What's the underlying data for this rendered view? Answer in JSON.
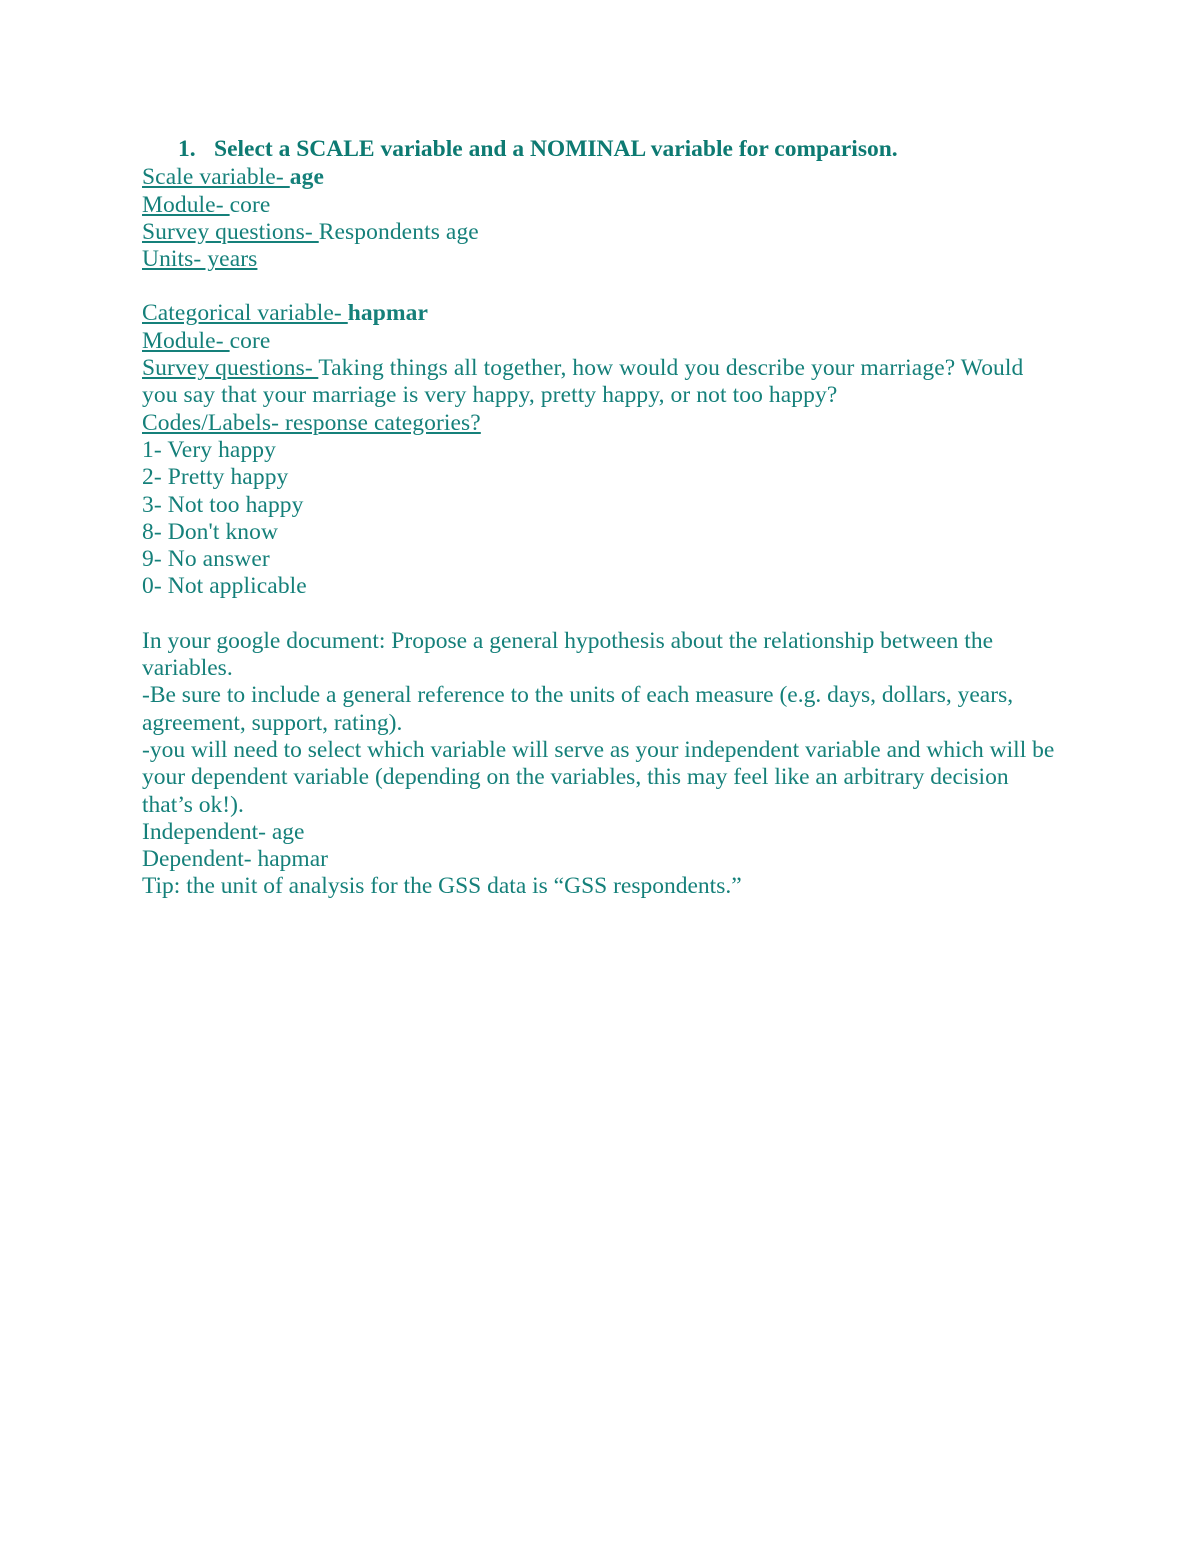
{
  "document": {
    "text_color": "#15807a",
    "heading_color": "#0d7a72",
    "numbered_item": {
      "number": "1.",
      "text": "Select a SCALE variable and a NOMINAL variable for comparison."
    },
    "scale_block": {
      "variable_label": "Scale variable- ",
      "variable_value": "age",
      "module_label": "Module- ",
      "module_value": "core",
      "survey_label": "Survey questions- ",
      "survey_value": "Respondents age",
      "units_line": "Units- years"
    },
    "categorical_block": {
      "variable_label": "Categorical variable- ",
      "variable_value": "hapmar",
      "module_label": "Module- ",
      "module_value": "core",
      "survey_label": "Survey questions- ",
      "survey_value": "Taking things all together, how would you describe your marriage? Would you say that your marriage is very happy, pretty happy, or not too happy?",
      "codes_header": "Codes/Labels- response categories?",
      "codes": [
        "1- Very happy",
        "2- Pretty happy",
        "3- Not too happy",
        "8- Don't know",
        "9- No answer",
        "0- Not applicable"
      ]
    },
    "instructions_block": {
      "line1": "In your google document: Propose a general hypothesis about the relationship between the variables.",
      "line2": "-Be sure to include a general reference to the units of each measure (e.g. days, dollars, years, agreement, support, rating).",
      "line3": "-you will need to select which variable will serve as your independent variable and which will be your dependent variable (depending on the variables, this may feel like an arbitrary decision that’s ok!).",
      "line4": "Independent- age",
      "line5": "Dependent- hapmar",
      "line6": "Tip: the unit of analysis for the GSS data is “GSS respondents.”"
    }
  }
}
